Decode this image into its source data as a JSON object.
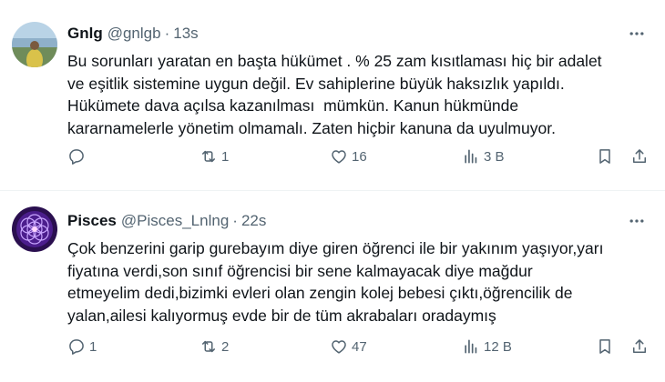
{
  "tweets": [
    {
      "name": "Gnlg",
      "handle": "@gnlgb",
      "separator": "·",
      "time": "13s",
      "text": "Bu sorunları yaratan en başta hükümet . % 25 zam kısıtlaması hiç bir adalet\nve eşitlik sistemine uygun değil. Ev sahiplerine büyük haksızlık yapıldı.\nHükümete dava açılsa kazanılması  mümkün. Kanun hükmünde\nkararnamelerle yönetim olmamalı. Zaten hiçbir kanuna da uyulmuyor.",
      "replies": "",
      "retweets": "1",
      "likes": "16",
      "views": "3 B",
      "avatar_icon": "profile-photo-icon"
    },
    {
      "name": "Pisces",
      "handle": "@Pisces_Lnlng",
      "separator": "·",
      "time": "22s",
      "text": "Çok benzerini garip gurebayım diye giren öğrenci ile bir yakınım yaşıyor,yarı\nfiyatına verdi,son sınıf öğrencisi bir sene kalmayacak diye mağdur\netmeyelim dedi,bizimki evleri olan zengin kolej bebesi çıktı,öğrencilik de\nyalan,ailesi kalıyormuş evde bir de tüm akrabaları oradaymış",
      "replies": "1",
      "retweets": "2",
      "likes": "47",
      "views": "12 B",
      "avatar_icon": "mandala-avatar-icon"
    }
  ],
  "colors": {
    "text": "#0f1419",
    "secondary": "#536471",
    "divider": "#eff3f4"
  }
}
